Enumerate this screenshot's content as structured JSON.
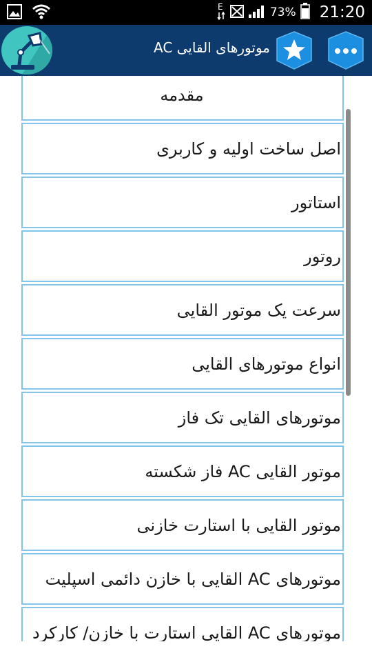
{
  "status_bar": {
    "icons": [
      "gallery-icon",
      "wifi-icon",
      "data-e-icon",
      "sim-off-icon",
      "signal-icon",
      "battery-icon"
    ],
    "battery_percent": "73%",
    "time": "21:20"
  },
  "app_bar": {
    "title": "موتورهای القایی AC",
    "logo": "desk-lamp-logo",
    "star_button": "star-icon",
    "more_button": "more-dots-icon",
    "colors": {
      "bar": "#0d3b6e",
      "button": "#1c8fe0",
      "logo_bg": "#41c5c0"
    }
  },
  "list": {
    "items": [
      "مقدمه",
      "اصل ساخت اولیه و کاربری",
      "استاتور",
      "روتور",
      "سرعت یک موتور القایی",
      "انواع موتورهای القایی",
      "موتورهای القایی تک فاز",
      "موتور القایی AC فاز شکسته",
      "موتور القایی با استارت خازنی",
      "موتورهای AC القایی با خازن دائمی اسپلیت",
      "موتورهای AC القایی استارت با خازن/ کارکرد"
    ],
    "border_color": "#82c4ea"
  }
}
